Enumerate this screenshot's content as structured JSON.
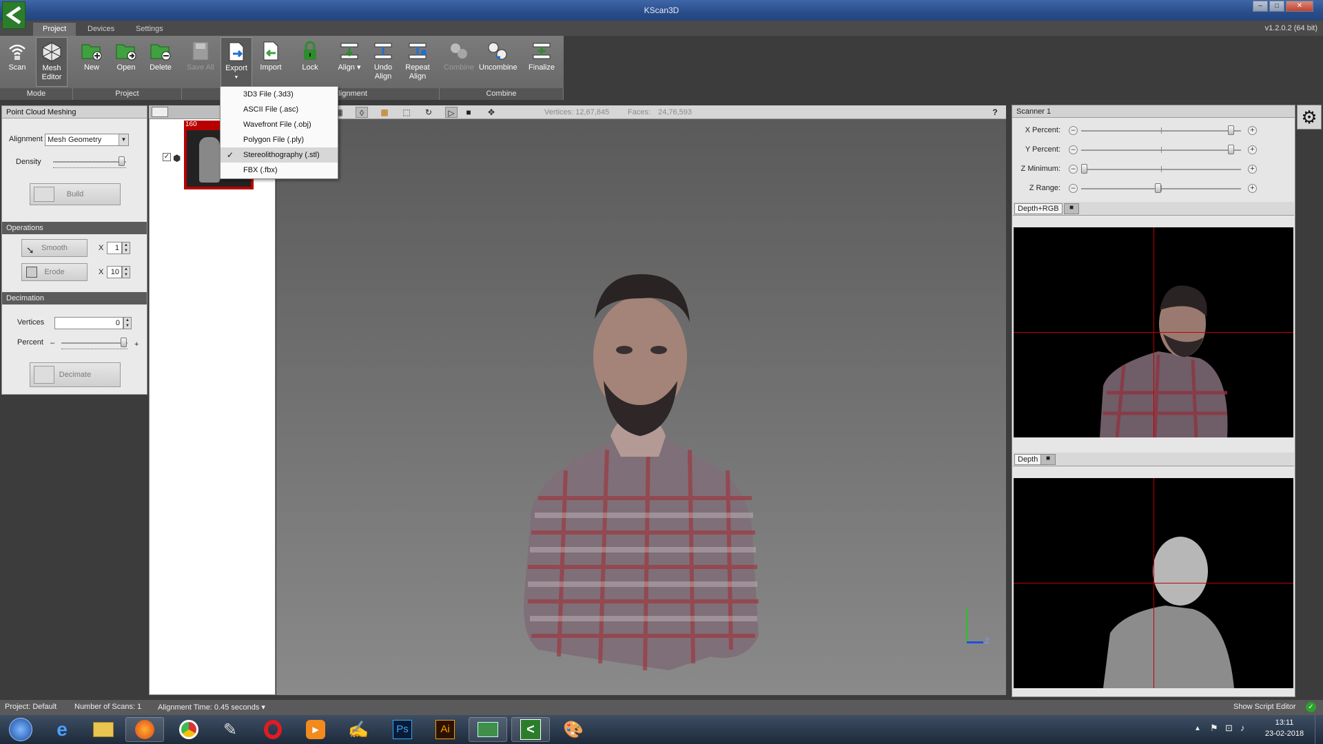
{
  "window": {
    "title": "KScan3D",
    "version": "v1.2.0.2  (64 bit)"
  },
  "tabs": [
    {
      "label": "Project"
    },
    {
      "label": "Devices"
    },
    {
      "label": "Settings"
    }
  ],
  "ribbon": {
    "buttons": {
      "scan": "Scan",
      "mesh_editor_1": "Mesh",
      "mesh_editor_2": "Editor",
      "new": "New",
      "open": "Open",
      "delete": "Delete",
      "save_all": "Save All",
      "export": "Export",
      "import": "Import",
      "lock": "Lock",
      "align": "Align",
      "undo_align_1": "Undo",
      "undo_align_2": "Align",
      "repeat_align_1": "Repeat",
      "repeat_align_2": "Align",
      "combine": "Combine",
      "uncombine": "Uncombine",
      "finalize": "Finalize"
    },
    "groups": {
      "mode": "Mode",
      "project": "Project",
      "alignment": "Alignment",
      "combine": "Combine"
    }
  },
  "export_menu": {
    "items": [
      "3D3 File (.3d3)",
      "ASCII File (.asc)",
      "Wavefront File (.obj)",
      "Polygon File (.ply)",
      "Stereolithography (.stl)",
      "FBX (.fbx)"
    ],
    "checked": "Stereolithography (.stl)"
  },
  "left_panel": {
    "point_cloud_meshing": {
      "title": "Point Cloud Meshing",
      "alignment_label": "Alignment",
      "alignment_value": "Mesh Geometry",
      "density_label": "Density",
      "build": "Build"
    },
    "operations": {
      "title": "Operations",
      "smooth": "Smooth",
      "smooth_x": "X",
      "smooth_count": "1",
      "erode": "Erode",
      "erode_x": "X",
      "erode_count": "10"
    },
    "decimation": {
      "title": "Decimation",
      "vertices_label": "Vertices",
      "vertices_value": "0",
      "percent_label": "Percent",
      "minus": "–",
      "plus": "+",
      "decimate": "Decimate"
    }
  },
  "tree": {
    "thumb_count": "160"
  },
  "viewport": {
    "vertices_label": "Vertices:",
    "vertices_value": "12,67,845",
    "faces_label": "Faces:",
    "faces_value": "24,76,593",
    "help": "?",
    "axis_z": "Z"
  },
  "scanner": {
    "title": "Scanner 1",
    "sliders": [
      {
        "label": "X Percent:",
        "value": 0.96
      },
      {
        "label": "Y Percent:",
        "value": 0.96
      },
      {
        "label": "Z Minimum:",
        "value": 0.0
      },
      {
        "label": "Z Range:",
        "value": 0.48
      }
    ],
    "depth_rgb_tab": "Depth+RGB",
    "depth_tab": "Depth"
  },
  "statusbar": {
    "project": "Project:  Default",
    "scans": "Number of Scans:  1",
    "alignment_time": "Alignment Time:  0.45 seconds",
    "script_editor": "Show Script Editor"
  },
  "taskbar": {
    "time": "13:11",
    "date": "23-02-2018",
    "ps": "Ps",
    "ai": "Ai"
  },
  "colors": {
    "accent_green": "#2b7d2b",
    "thumb_border": "#b80000",
    "crosshair": "#c00000"
  }
}
